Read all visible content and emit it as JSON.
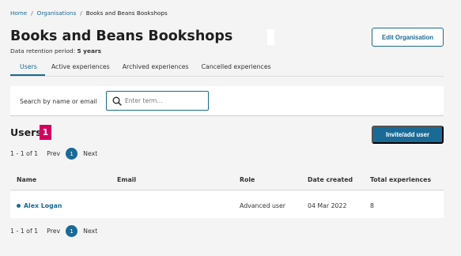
{
  "breadcrumb": {
    "home": "Home",
    "separator": "/",
    "organisations": "Organisations",
    "current": "Books and Beans Bookshops"
  },
  "header": {
    "title": "Books and Beans Bookshops",
    "retention_label": "Data retention period:",
    "retention_value": "5 years",
    "edit_button": "Edit Organisation"
  },
  "tabs": [
    {
      "label": "Users",
      "active": true
    },
    {
      "label": "Active experiences",
      "active": false
    },
    {
      "label": "Archived experiences",
      "active": false
    },
    {
      "label": "Cancelled experiences",
      "active": false
    }
  ],
  "search": {
    "label": "Search by name or email",
    "placeholder": "Enter term...",
    "value": ""
  },
  "users": {
    "title": "Users",
    "count": "1",
    "invite_button": "Invite/add user"
  },
  "pagination": {
    "range": "1 - 1 of 1",
    "prev": "Prev",
    "page": "1",
    "next": "Next"
  },
  "table": {
    "columns": [
      "Name",
      "Email",
      "Role",
      "Date created",
      "Total experiences"
    ],
    "rows": [
      {
        "name": "Alex Logan",
        "email": "",
        "role": "Advanced user",
        "date_created": "04 Mar 2022",
        "total_experiences": "8"
      }
    ]
  },
  "colors": {
    "accent": "#1a6a96",
    "badge": "#d4005f",
    "background": "#f4f4f4"
  }
}
